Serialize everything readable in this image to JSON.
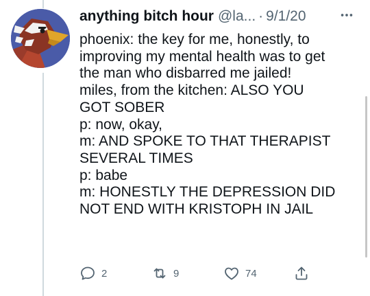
{
  "tweet": {
    "author": {
      "display_name": "anything bitch hour",
      "handle": "@la...",
      "avatar_icon": "bird-character-avatar-icon"
    },
    "separator": "·",
    "date": "9/1/20",
    "more_icon": "more-horizontal-icon",
    "text_lines": [
      "phoenix: the key for me, honestly, to",
      "improving my mental health was to get",
      "the man who disbarred me jailed!",
      "miles, from the kitchen: ALSO YOU",
      "GOT SOBER",
      "p: now, okay,",
      "m: AND SPOKE TO THAT THERAPIST",
      "SEVERAL TIMES",
      "p: babe",
      "m: HONESTLY THE DEPRESSION DID",
      "NOT END WITH KRISTOPH IN JAIL"
    ],
    "actions": {
      "reply": {
        "icon": "reply-icon",
        "count": "2"
      },
      "retweet": {
        "icon": "retweet-icon",
        "count": "9"
      },
      "like": {
        "icon": "heart-icon",
        "count": "74"
      },
      "share": {
        "icon": "share-icon"
      }
    }
  },
  "colors": {
    "text_primary": "#0f1419",
    "text_secondary": "#536471",
    "thread_line": "#cfd9de",
    "avatar_background": "#4a5ba8"
  }
}
